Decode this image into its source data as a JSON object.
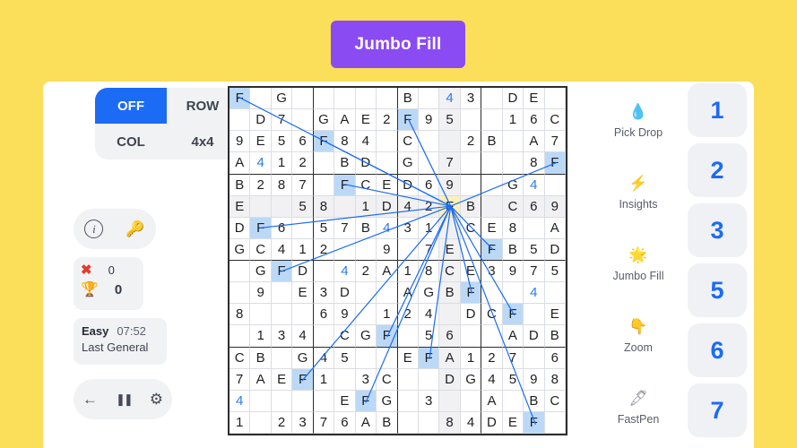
{
  "theme": {
    "page_bg": "#FBDE5A",
    "title_bg": "#8A4BF3",
    "accent_blue": "#1B6BF5",
    "highlight_blue": "#BBD9F7",
    "selected_yellow": "#FDF0B8",
    "panel_gray": "#F1F2F4"
  },
  "header": {
    "title": "Jumbo Fill"
  },
  "left_panel": {
    "mode_pad": [
      {
        "label": "OFF",
        "active": true
      },
      {
        "label": "ROW",
        "active": false
      },
      {
        "label": "COL",
        "active": false
      },
      {
        "label": "4x4",
        "active": false
      }
    ],
    "tools": [
      {
        "name": "info-icon",
        "glyph": "i"
      },
      {
        "name": "key-icon",
        "glyph": "🔑"
      }
    ],
    "score": {
      "mistakes_icon": "✖",
      "mistakes": "0",
      "trophy_icon": "🏆",
      "score": "0"
    },
    "status": {
      "difficulty": "Easy",
      "timer": "07:52",
      "subtitle": "Last General"
    },
    "nav": [
      {
        "name": "back-button",
        "glyph": "←"
      },
      {
        "name": "pause-button",
        "glyph": "❚❚"
      },
      {
        "name": "settings-button",
        "glyph": "⚙"
      }
    ]
  },
  "right_tools": [
    {
      "label": "Pick Drop",
      "icon": "water-drop-icon",
      "glyph": "💧",
      "color": "#F5BE33"
    },
    {
      "label": "Insights",
      "icon": "lightning-bolt-icon",
      "glyph": "⚡",
      "color": "#F5BE33"
    },
    {
      "label": "Jumbo Fill",
      "icon": "sparkle-star-icon",
      "glyph": "🌟",
      "color": "#F5BE33"
    },
    {
      "label": "Zoom",
      "icon": "pointing-hand-icon",
      "glyph": "👇",
      "color": "#F5BE33"
    },
    {
      "label": "FastPen",
      "icon": "fountain-pen-icon",
      "glyph": "🖋",
      "color": "#8A8F99"
    }
  ],
  "numpad": [
    "1",
    "2",
    "3",
    "5",
    "6",
    "7"
  ],
  "grid": {
    "size": 16,
    "box": 4,
    "selected_cell": {
      "row": 5,
      "col": 10,
      "value": "F"
    },
    "rows": [
      [
        "F",
        "",
        "G",
        "",
        "",
        "",
        "",
        "",
        "B",
        "",
        "4",
        "3",
        "",
        "D",
        "E",
        ""
      ],
      [
        "",
        "D",
        "7",
        "",
        "G",
        "A",
        "E",
        "2",
        "F",
        "9",
        "5",
        "",
        "",
        "1",
        "6",
        "C"
      ],
      [
        "9",
        "E",
        "5",
        "6",
        "F",
        "8",
        "4",
        "",
        "C",
        "",
        "",
        "2",
        "B",
        "",
        "A",
        "7"
      ],
      [
        "A",
        "4",
        "1",
        "2",
        "",
        "B",
        "D",
        "",
        "G",
        "",
        "7",
        "",
        "",
        "",
        "8",
        "F"
      ],
      [
        "B",
        "2",
        "8",
        "7",
        "",
        "F",
        "C",
        "E",
        "D",
        "6",
        "9",
        "",
        "",
        "G",
        "4",
        ""
      ],
      [
        "E",
        "",
        "",
        "5",
        "8",
        "",
        "1",
        "D",
        "4",
        "2",
        "F",
        "B",
        "",
        "C",
        "6",
        "9"
      ],
      [
        "D",
        "F",
        "6",
        "",
        "5",
        "7",
        "B",
        "4",
        "3",
        "1",
        "",
        "C",
        "E",
        "8",
        "",
        "A"
      ],
      [
        "G",
        "C",
        "4",
        "1",
        "2",
        "",
        "",
        "9",
        "",
        "7",
        "E",
        "",
        "F",
        "B",
        "5",
        "D"
      ],
      [
        "",
        "G",
        "F",
        "D",
        "",
        "4",
        "2",
        "A",
        "1",
        "8",
        "C",
        "E",
        "3",
        "9",
        "7",
        "5"
      ],
      [
        "",
        "9",
        "",
        "E",
        "3",
        "D",
        "",
        "",
        "A",
        "G",
        "B",
        "F",
        "",
        "",
        "4",
        ""
      ],
      [
        "8",
        "",
        "",
        "",
        "6",
        "9",
        "",
        "1",
        "2",
        "4",
        "",
        "D",
        "C",
        "F",
        "",
        "E"
      ],
      [
        "",
        "1",
        "3",
        "4",
        "",
        "C",
        "G",
        "F",
        "",
        "5",
        "6",
        "",
        "",
        "A",
        "D",
        "B"
      ],
      [
        "C",
        "B",
        "",
        "G",
        "4",
        "5",
        "",
        "",
        "E",
        "F",
        "A",
        "1",
        "2",
        "7",
        "",
        "6"
      ],
      [
        "7",
        "A",
        "E",
        "F",
        "1",
        "",
        "3",
        "C",
        "",
        "",
        "D",
        "G",
        "4",
        "5",
        "9",
        "8"
      ],
      [
        "4",
        "",
        "",
        "",
        "",
        "E",
        "F",
        "G",
        "",
        "3",
        "",
        "",
        "A",
        "",
        "B",
        "C"
      ],
      [
        "1",
        "",
        "2",
        "3",
        "7",
        "6",
        "A",
        "B",
        "",
        "",
        "8",
        "4",
        "D",
        "E",
        "F",
        ""
      ]
    ],
    "blue_cells": [
      {
        "r": 0,
        "c": 10
      },
      {
        "r": 3,
        "c": 1
      },
      {
        "r": 4,
        "c": 14
      },
      {
        "r": 6,
        "c": 7
      },
      {
        "r": 8,
        "c": 5
      },
      {
        "r": 9,
        "c": 14
      },
      {
        "r": 14,
        "c": 0
      }
    ],
    "highlight_cells": [
      {
        "r": 0,
        "c": 0
      },
      {
        "r": 1,
        "c": 8
      },
      {
        "r": 2,
        "c": 4
      },
      {
        "r": 3,
        "c": 15
      },
      {
        "r": 4,
        "c": 5
      },
      {
        "r": 6,
        "c": 1
      },
      {
        "r": 7,
        "c": 12
      },
      {
        "r": 8,
        "c": 2
      },
      {
        "r": 9,
        "c": 11
      },
      {
        "r": 10,
        "c": 13
      },
      {
        "r": 11,
        "c": 7
      },
      {
        "r": 12,
        "c": 9
      },
      {
        "r": 13,
        "c": 3
      },
      {
        "r": 14,
        "c": 6
      },
      {
        "r": 15,
        "c": 14
      }
    ],
    "shaded_columns": [
      10
    ],
    "shaded_rows": [
      5
    ],
    "connector_color": "#1B6BF5"
  }
}
